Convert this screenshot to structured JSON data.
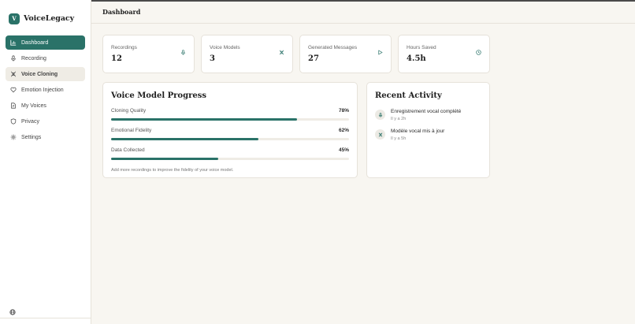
{
  "brand": {
    "logo_letter": "V",
    "name": "VoiceLegacy"
  },
  "header": {
    "title": "Dashboard"
  },
  "sidebar": {
    "items": [
      {
        "label": "Dashboard",
        "icon": "bar-chart-icon",
        "state": "active"
      },
      {
        "label": "Recording",
        "icon": "mic-icon",
        "state": "normal"
      },
      {
        "label": "Voice Cloning",
        "icon": "dna-icon",
        "state": "hover"
      },
      {
        "label": "Emotion Injection",
        "icon": "heart-icon",
        "state": "normal"
      },
      {
        "label": "My Voices",
        "icon": "file-audio-icon",
        "state": "normal"
      },
      {
        "label": "Privacy",
        "icon": "shield-icon",
        "state": "normal"
      },
      {
        "label": "Settings",
        "icon": "gear-icon",
        "state": "normal"
      }
    ],
    "footer_icon": "globe-icon"
  },
  "stats": [
    {
      "label": "Recordings",
      "value": "12",
      "icon": "mic-icon"
    },
    {
      "label": "Voice Models",
      "value": "3",
      "icon": "dna-icon"
    },
    {
      "label": "Generated Messages",
      "value": "27",
      "icon": "play-icon"
    },
    {
      "label": "Hours Saved",
      "value": "4.5h",
      "icon": "clock-icon"
    }
  ],
  "progress": {
    "title": "Voice Model Progress",
    "items": [
      {
        "label": "Cloning Quality",
        "percent_text": "78%",
        "value": 78
      },
      {
        "label": "Emotional Fidelity",
        "percent_text": "62%",
        "value": 62
      },
      {
        "label": "Data Collected",
        "percent_text": "45%",
        "value": 45
      }
    ],
    "hint": "Add more recordings to improve the fidelity of your voice model."
  },
  "activity": {
    "title": "Recent Activity",
    "items": [
      {
        "title": "Enregistrement vocal complété",
        "time": "Il y a 2h",
        "icon": "mic-icon"
      },
      {
        "title": "Modèle vocal mis à jour",
        "time": "Il y a 5h",
        "icon": "dna-icon"
      }
    ]
  },
  "colors": {
    "accent": "#2a7268",
    "background": "#f8f6f1",
    "card": "#ffffff",
    "track": "#efece5"
  }
}
